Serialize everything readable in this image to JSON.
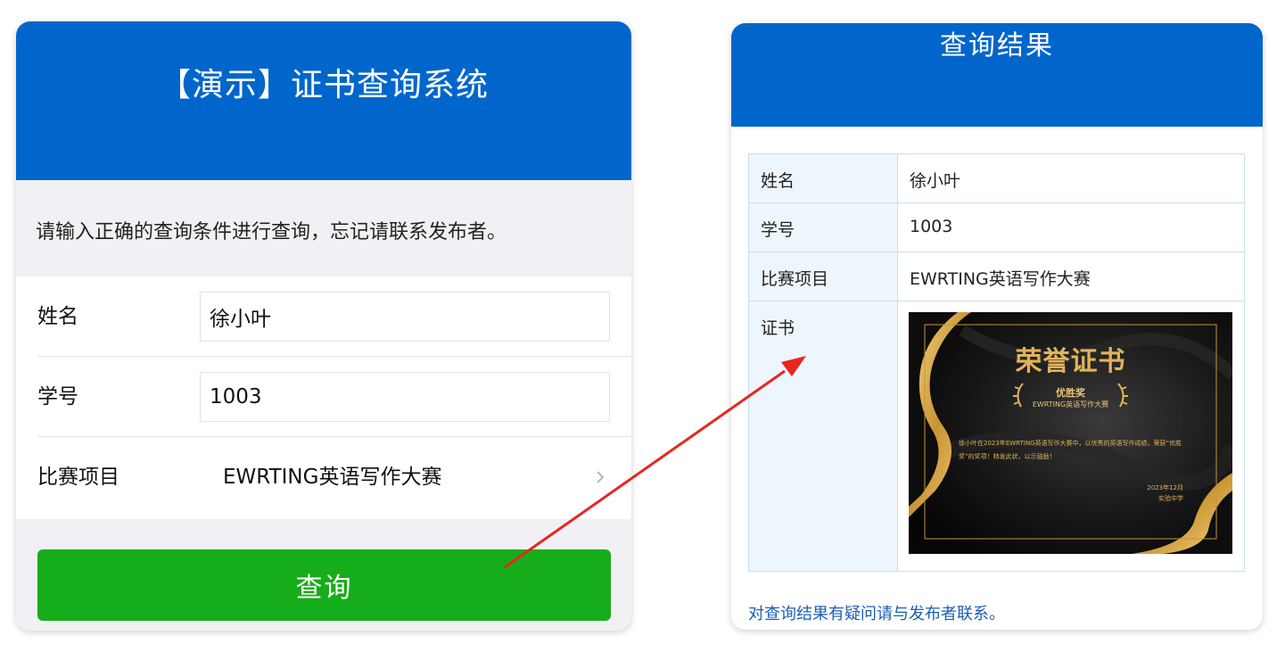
{
  "query_form": {
    "title": "【演示】证书查询系统",
    "instruction": "请输入正确的查询条件进行查询，忘记请联系发布者。",
    "fields": {
      "name": {
        "label": "姓名",
        "value": "徐小叶"
      },
      "student_id": {
        "label": "学号",
        "value": "1003"
      },
      "contest": {
        "label": "比赛项目",
        "value": "EWRTING英语写作大赛"
      }
    },
    "submit_label": "查询"
  },
  "result": {
    "title": "查询结果",
    "rows": [
      {
        "label": "姓名",
        "value": "徐小叶"
      },
      {
        "label": "学号",
        "value": "1003"
      },
      {
        "label": "比赛项目",
        "value": "EWRTING英语写作大赛"
      },
      {
        "label": "证书"
      }
    ],
    "certificate": {
      "title": "荣誉证书",
      "award": "优胜奖",
      "contest": "EWRTING英语写作大赛",
      "body": "徐小叶在2023年EWRTING英语写作大赛中，以优秀的英语写作成绩，荣获“优胜奖”的奖项！特发此状，以示鼓励！",
      "date": "2023年12月",
      "issuer": "实验中学"
    },
    "contact_note": "对查询结果有疑问请与发布者联系。"
  },
  "colors": {
    "header_blue": "#0066cc",
    "button_green": "#16ad1a",
    "arrow_red": "#e8261e",
    "cert_gold": "#e2b25a"
  },
  "icons": [
    "chevron-right-icon",
    "laurel-left-icon",
    "laurel-right-icon"
  ]
}
